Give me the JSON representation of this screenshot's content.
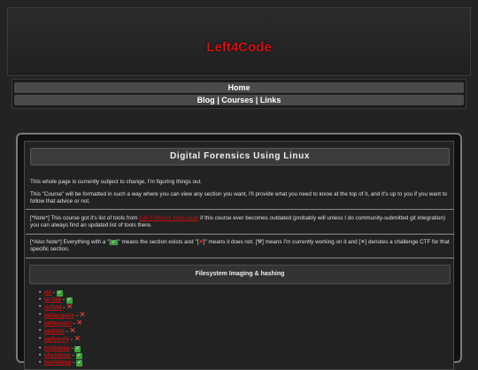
{
  "header": {
    "title": "Left4Code"
  },
  "nav": {
    "home": "Home",
    "blog": "Blog",
    "courses": "Courses",
    "links": "Links",
    "sep": "|"
  },
  "page": {
    "title": "Digital Forensics Using Linux",
    "p1": "This whole page is currently subject to change, I'm figuring things out.",
    "p2": "This \"Course\" will be formatted in such a way where you can view any section you want, I'll provide what you need to know at the top of it, and it's up to you if you want to follow that advice or not.",
    "note1_a": "[*Note*] This course got it's list of tools from ",
    "note1_link": "Kali Forensic tools page",
    "note1_b": " if this course ever becomes outdated (probably will unless I do community-submitted git integration) you can always find an updated list of tools there.",
    "note2_a": "[*Also Note*] Everything with a \"[",
    "note2_b": "]\" means the section exists and \"[",
    "note2_c": "]\" means it does not. [",
    "note2_d": "] means I'm currently working on it and [",
    "note2_e": "] denotes a challenge CTF for that specific section.",
    "icons": {
      "check": "✓",
      "cross": "✕",
      "working": "⚒",
      "ctf": "✕"
    }
  },
  "section": {
    "title": "Filesystem Imaging & hashing",
    "list1": [
      {
        "name": "dd",
        "status": "check"
      },
      {
        "name": "dc3dd",
        "status": "check"
      },
      {
        "name": "dcfldd",
        "status": "cross"
      },
      {
        "name": "ewfacquire",
        "status": "cross"
      },
      {
        "name": "ewfexport",
        "status": "cross"
      },
      {
        "name": "ewfinfo",
        "status": "cross"
      },
      {
        "name": "ewfverify",
        "status": "cross"
      }
    ],
    "list2": [
      {
        "name": "md5deep",
        "status": "check"
      },
      {
        "name": "sha1deep",
        "status": "check"
      },
      {
        "name": "hashdeep",
        "status": "check"
      }
    ],
    "separator": " - "
  }
}
